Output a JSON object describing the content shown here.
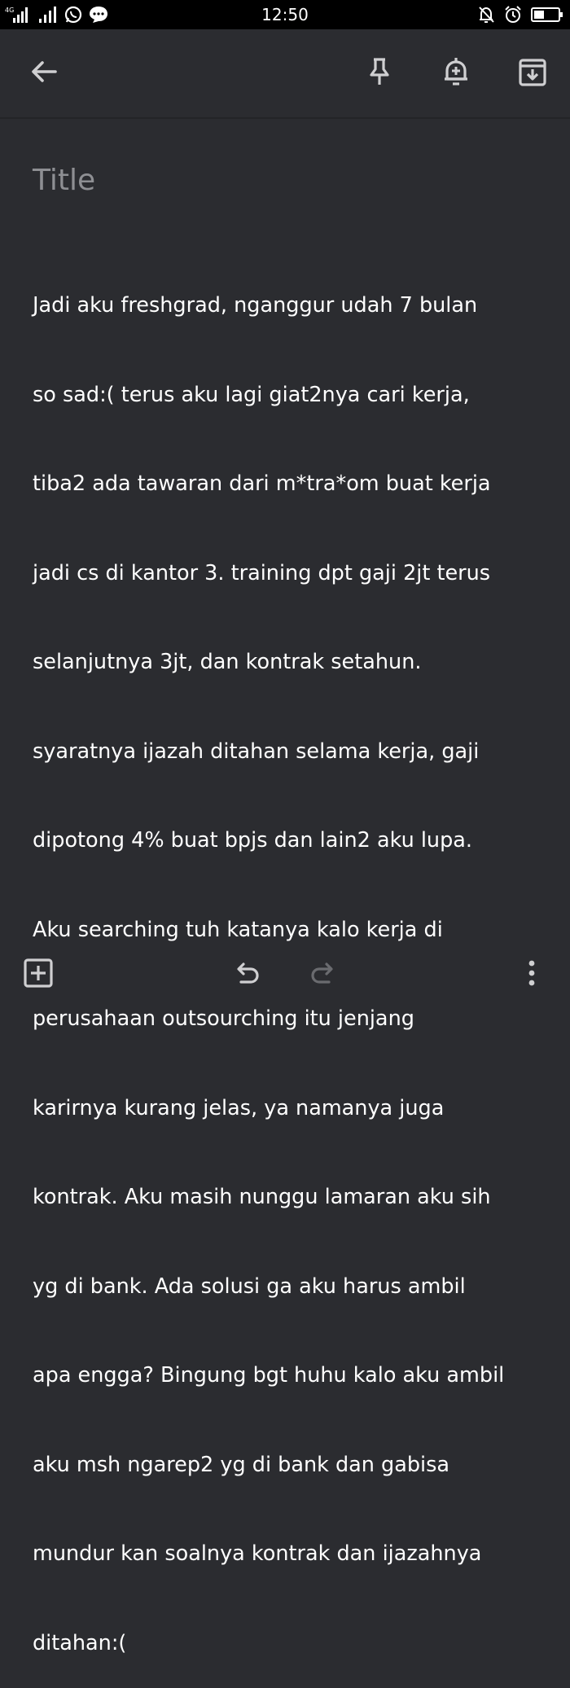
{
  "status_bar": {
    "time": "12:50",
    "network_badge": "4G",
    "icons": [
      "signal-icon",
      "signal-icon",
      "whatsapp-icon",
      "chat-icon",
      "muted-bell-icon",
      "alarm-icon",
      "battery-icon"
    ]
  },
  "toolbar": {
    "icons": [
      "back-arrow-icon",
      "pin-icon",
      "reminder-icon",
      "archive-icon"
    ]
  },
  "note": {
    "title_placeholder": "Title",
    "body_lines": [
      "Jadi aku freshgrad, nganggur udah 7 bulan",
      "so sad:( terus aku lagi giat2nya cari kerja,",
      "tiba2 ada tawaran dari m*tra*om buat kerja",
      "jadi cs di kantor 3. training dpt gaji 2jt terus",
      "selanjutnya 3jt, dan kontrak setahun.",
      "syaratnya ijazah ditahan selama kerja, gaji",
      "dipotong 4% buat bpjs dan lain2 aku lupa.",
      "Aku searching tuh katanya kalo kerja di",
      "perusahaan outsourching itu jenjang",
      "karirnya kurang jelas, ya namanya juga",
      "kontrak. Aku masih nunggu lamaran aku sih",
      "yg di bank. Ada solusi ga aku harus ambil",
      "apa engga? Bingung bgt huhu kalo aku ambil",
      "aku msh ngarep2 yg di bank dan gabisa",
      "mundur kan soalnya kontrak dan ijazahnya",
      "ditahan:("
    ]
  },
  "bottom_bar": {
    "icons": [
      "add-box-icon",
      "undo-icon",
      "redo-icon",
      "more-vert-icon"
    ]
  },
  "colors": {
    "background": "#2b2c30",
    "status_bar": "#000000",
    "text": "#ffffff",
    "placeholder": "#8e8f93",
    "icon": "#cfcfd1",
    "icon_disabled": "#6a6b6f"
  }
}
